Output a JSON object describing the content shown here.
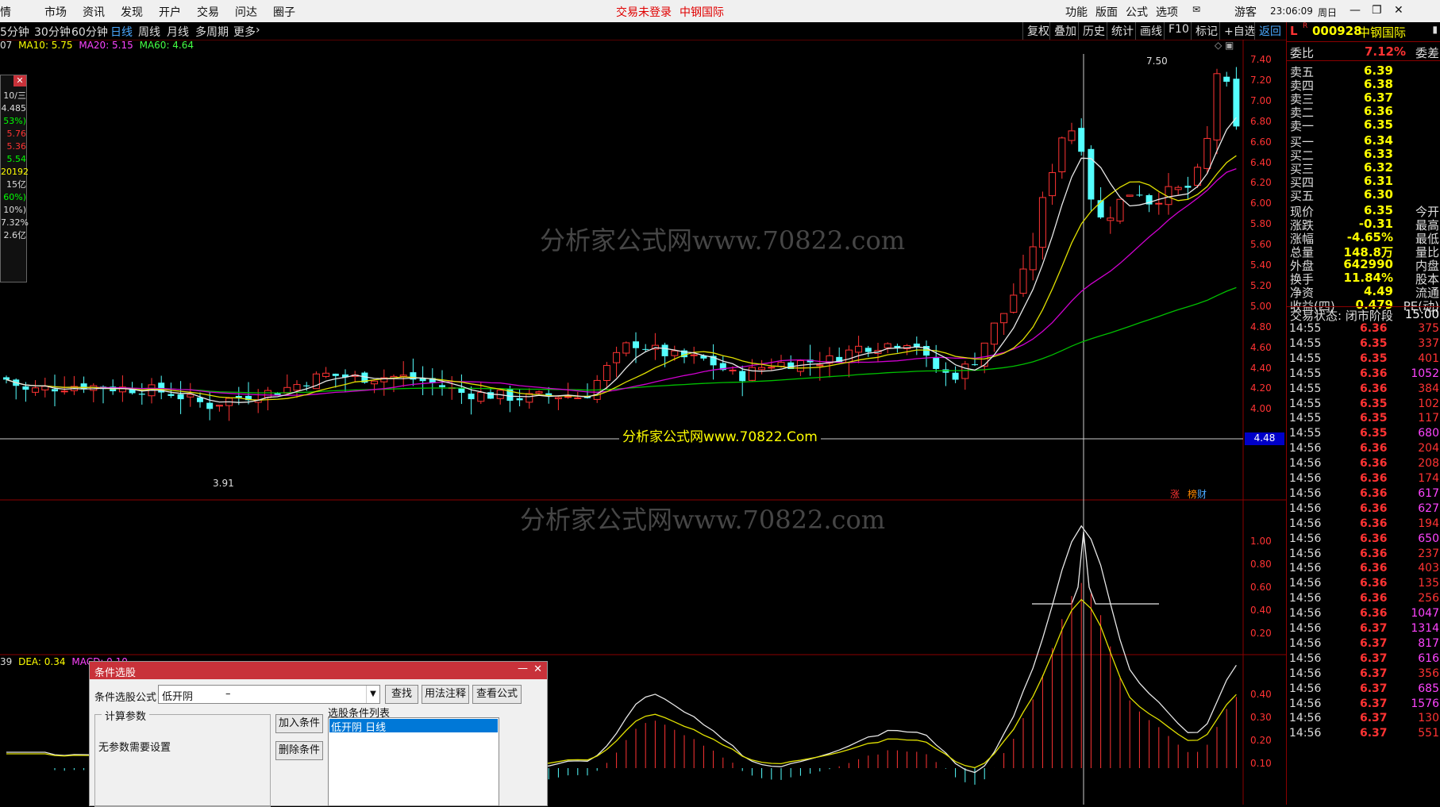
{
  "topbar": {
    "menus": [
      "市场",
      "资讯",
      "发现",
      "开户",
      "交易",
      "问达",
      "圈子"
    ],
    "left_clip": "情",
    "status_login": "交易未登录",
    "status_stock": "中钢国际",
    "right_menus": [
      "功能",
      "版面",
      "公式",
      "选项"
    ],
    "user": "游客",
    "time": "23:06:09",
    "weekday": "周日"
  },
  "periods": [
    "5分钟",
    "30分钟",
    "60分钟",
    "日线",
    "周线",
    "月线",
    "多周期",
    "更多"
  ],
  "active_period": "日线",
  "toolbar_buttons": [
    "复权",
    "叠加",
    "历史",
    "统计",
    "画线",
    "F10",
    "标记",
    "+自选",
    "返回"
  ],
  "ma_legend": {
    "prefix": "07",
    "ma10": "MA10: 5.75",
    "ma20": "MA20: 5.15",
    "ma60": "MA60: 4.64"
  },
  "left_info_labels": [
    "10/三",
    "4.485",
    "53%)",
    "5.76",
    "5.36",
    "5.54",
    "20192",
    "15亿",
    "60%)",
    "10%)",
    "7.32%",
    "2.6亿"
  ],
  "price_axis": [
    "7.40",
    "7.20",
    "7.00",
    "6.80",
    "6.60",
    "6.40",
    "6.20",
    "6.00",
    "5.80",
    "5.60",
    "5.40",
    "5.20",
    "5.00",
    "4.80",
    "4.60",
    "4.40",
    "4.20",
    "4.00"
  ],
  "cursor_price": "4.48",
  "high_label": "7.50",
  "low_label": "3.91",
  "watermark_center": "分析家公式网www.70822.Com",
  "watermarks": [
    "分析家公式网www.70822.com",
    "分析家公式网www.70822.com"
  ],
  "tags": [
    "涨",
    "榜",
    "财"
  ],
  "ind_axis": [
    "1.00",
    "0.80",
    "0.60",
    "0.40",
    "0.20"
  ],
  "macd_legend": {
    "prefix": "39",
    "dea": "DEA: 0.34",
    "macd": "MACD: 0.10"
  },
  "macd_axis": [
    "0.40",
    "0.30",
    "0.20",
    "0.10"
  ],
  "quote": {
    "flag": "L",
    "flag_r": "R",
    "code": "000928",
    "name": "中钢国际",
    "weibi_label": "委比",
    "weibi": "7.12%",
    "weicha_label": "委差",
    "sell": [
      {
        "l": "卖五",
        "p": "6.39"
      },
      {
        "l": "卖四",
        "p": "6.38"
      },
      {
        "l": "卖三",
        "p": "6.37"
      },
      {
        "l": "卖二",
        "p": "6.36"
      },
      {
        "l": "卖一",
        "p": "6.35"
      }
    ],
    "buy": [
      {
        "l": "买一",
        "p": "6.34"
      },
      {
        "l": "买二",
        "p": "6.33"
      },
      {
        "l": "买三",
        "p": "6.32"
      },
      {
        "l": "买四",
        "p": "6.31"
      },
      {
        "l": "买五",
        "p": "6.30"
      }
    ],
    "stats": [
      {
        "l": "现价",
        "v": "6.35",
        "x": "今开"
      },
      {
        "l": "涨跌",
        "v": "-0.31",
        "x": "最高"
      },
      {
        "l": "涨幅",
        "v": "-4.65%",
        "x": "最低"
      },
      {
        "l": "总量",
        "v": "148.8万",
        "x": "量比"
      },
      {
        "l": "外盘",
        "v": "642990",
        "x": "内盘"
      },
      {
        "l": "换手",
        "v": "11.84%",
        "x": "股本"
      },
      {
        "l": "净资",
        "v": "4.49",
        "x": "流通"
      },
      {
        "l": "收益(四)",
        "v": "0.479",
        "x": "PE(动)"
      }
    ],
    "trade_state": "交易状态: 闭市阶段",
    "trade_time": "15:00",
    "ticks": [
      {
        "t": "14:55",
        "p": "6.36",
        "v": "375"
      },
      {
        "t": "14:55",
        "p": "6.35",
        "v": "337"
      },
      {
        "t": "14:55",
        "p": "6.35",
        "v": "401"
      },
      {
        "t": "14:55",
        "p": "6.36",
        "v": "1052"
      },
      {
        "t": "14:55",
        "p": "6.36",
        "v": "384"
      },
      {
        "t": "14:55",
        "p": "6.35",
        "v": "102"
      },
      {
        "t": "14:55",
        "p": "6.35",
        "v": "117"
      },
      {
        "t": "14:55",
        "p": "6.35",
        "v": "680"
      },
      {
        "t": "14:56",
        "p": "6.36",
        "v": "204"
      },
      {
        "t": "14:56",
        "p": "6.36",
        "v": "208"
      },
      {
        "t": "14:56",
        "p": "6.36",
        "v": "174"
      },
      {
        "t": "14:56",
        "p": "6.36",
        "v": "617"
      },
      {
        "t": "14:56",
        "p": "6.36",
        "v": "627"
      },
      {
        "t": "14:56",
        "p": "6.36",
        "v": "194"
      },
      {
        "t": "14:56",
        "p": "6.36",
        "v": "650"
      },
      {
        "t": "14:56",
        "p": "6.36",
        "v": "237"
      },
      {
        "t": "14:56",
        "p": "6.36",
        "v": "403"
      },
      {
        "t": "14:56",
        "p": "6.36",
        "v": "135"
      },
      {
        "t": "14:56",
        "p": "6.36",
        "v": "256"
      },
      {
        "t": "14:56",
        "p": "6.36",
        "v": "1047"
      },
      {
        "t": "14:56",
        "p": "6.37",
        "v": "1314"
      },
      {
        "t": "14:56",
        "p": "6.37",
        "v": "817"
      },
      {
        "t": "14:56",
        "p": "6.37",
        "v": "616"
      },
      {
        "t": "14:56",
        "p": "6.37",
        "v": "356"
      },
      {
        "t": "14:56",
        "p": "6.37",
        "v": "685"
      },
      {
        "t": "14:56",
        "p": "6.37",
        "v": "1576"
      },
      {
        "t": "14:56",
        "p": "6.37",
        "v": "130"
      },
      {
        "t": "14:56",
        "p": "6.37",
        "v": "551"
      }
    ]
  },
  "dialog": {
    "title": "条件选股",
    "formula_label": "条件选股公式",
    "formula_value": "低开阴",
    "formula_suffix": "–",
    "btn_find": "查找",
    "btn_usage": "用法注释",
    "btn_view": "查看公式",
    "params_title": "计算参数",
    "params_note": "无参数需要设置",
    "btn_add": "加入条件",
    "btn_del": "删除条件",
    "list_title": "选股条件列表",
    "list_items": [
      "低开阴    日线"
    ]
  }
}
